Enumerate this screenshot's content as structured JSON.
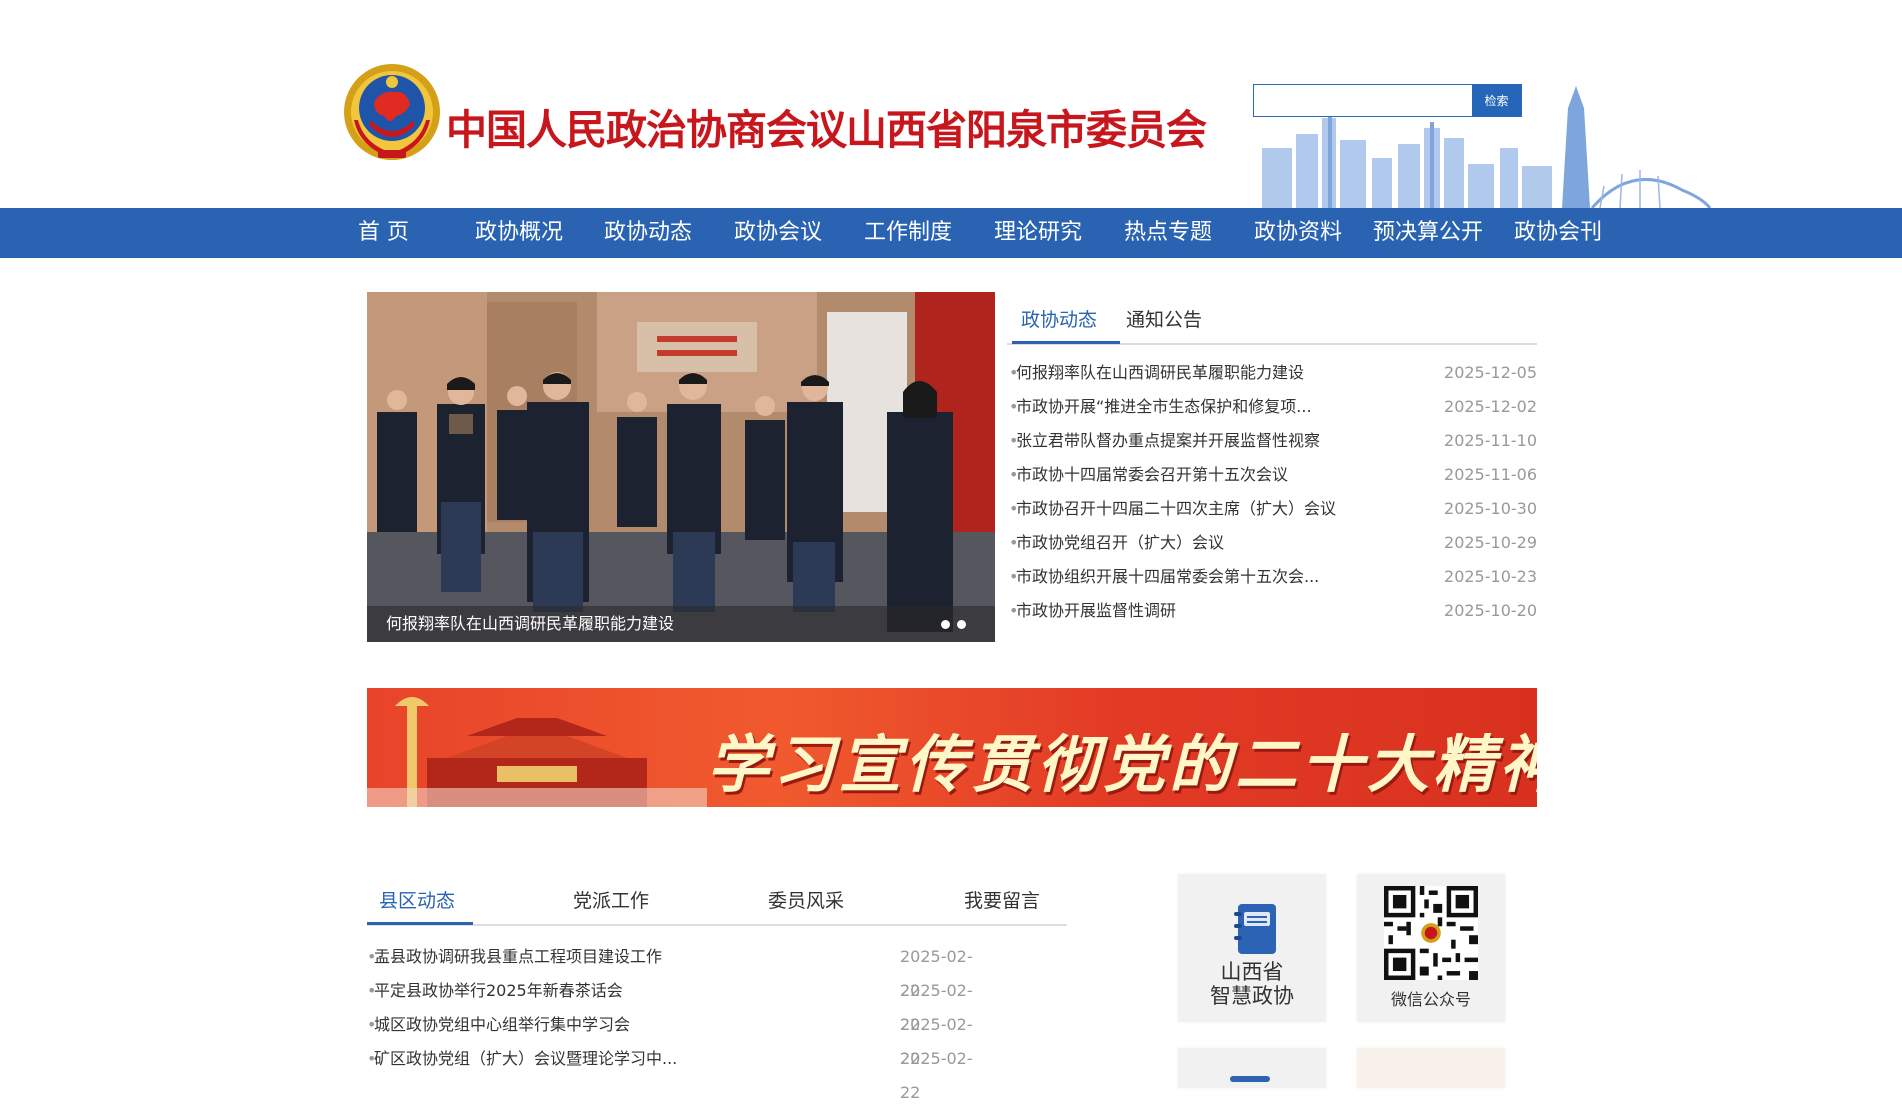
{
  "header": {
    "site_title": "中国人民政治协商会议山西省阳泉市委员会",
    "search": {
      "placeholder": "",
      "button_label": "检索"
    }
  },
  "nav": {
    "items": [
      {
        "label": "首  页"
      },
      {
        "label": "政协概况"
      },
      {
        "label": "政协动态"
      },
      {
        "label": "政协会议"
      },
      {
        "label": "工作制度"
      },
      {
        "label": "理论研究"
      },
      {
        "label": "热点专题"
      },
      {
        "label": "政协资料"
      },
      {
        "label": "预决算公开"
      },
      {
        "label": "政协会刊"
      }
    ]
  },
  "slideshow": {
    "caption": "何报翔率队在山西调研民革履职能力建设",
    "slide_count": 2,
    "active_index": 0
  },
  "news": {
    "tabs": [
      {
        "label": "政协动态"
      },
      {
        "label": "通知公告"
      }
    ],
    "active_tab": 0,
    "items": [
      {
        "title": "何报翔率队在山西调研民革履职能力建设",
        "date": "2025-12-05"
      },
      {
        "title": "市政协开展“推进全市生态保护和修复项...",
        "date": "2025-12-02"
      },
      {
        "title": "张立君带队督办重点提案并开展监督性视察",
        "date": "2025-11-10"
      },
      {
        "title": "市政协十四届常委会召开第十五次会议",
        "date": "2025-11-06"
      },
      {
        "title": "市政协召开十四届二十四次主席（扩大）会议",
        "date": "2025-10-30"
      },
      {
        "title": "市政协党组召开（扩大）会议",
        "date": "2025-10-29"
      },
      {
        "title": "市政协组织开展十四届常委会第十五次会...",
        "date": "2025-10-23"
      },
      {
        "title": "市政协开展监督性调研",
        "date": "2025-10-20"
      }
    ]
  },
  "banner": {
    "text": "学习宣传贯彻党的二十大精神"
  },
  "county_news": {
    "tabs": [
      {
        "label": "县区动态"
      },
      {
        "label": "党派工作"
      },
      {
        "label": "委员风采"
      },
      {
        "label": "我要留言"
      }
    ],
    "active_tab": 0,
    "items": [
      {
        "title": "盂县政协调研我县重点工程项目建设工作",
        "date": "2025-02-22"
      },
      {
        "title": "平定县政协举行2025年新春茶话会",
        "date": "2025-02-22"
      },
      {
        "title": "城区政协党组中心组举行集中学习会",
        "date": "2025-02-22"
      },
      {
        "title": "矿区政协党组（扩大）会议暨理论学习中...",
        "date": "2025-02-22"
      }
    ]
  },
  "side_tiles": {
    "smart_cppcc": {
      "line1": "山西省",
      "line2": "智慧政协",
      "icon": "notebook-icon"
    },
    "wechat": {
      "label": "微信公众号",
      "icon": "qr-code-icon"
    }
  },
  "colors": {
    "primary_blue": "#2a63b1",
    "title_red": "#c8161d",
    "date_gray": "#999999"
  }
}
